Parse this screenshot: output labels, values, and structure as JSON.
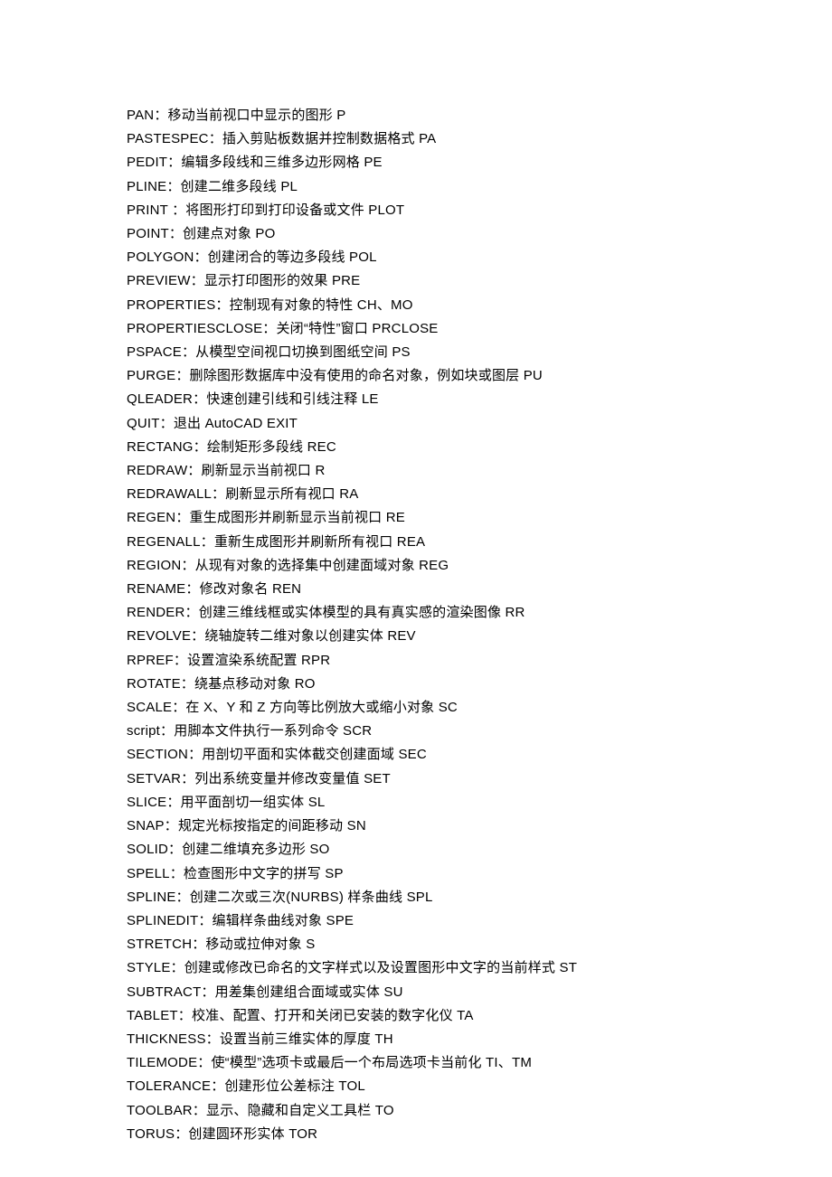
{
  "lines": [
    "PAN：移动当前视口中显示的图形 P",
    "PASTESPEC：插入剪贴板数据并控制数据格式 PA",
    "PEDIT：编辑多段线和三维多边形网格 PE",
    "PLINE：创建二维多段线 PL",
    "PRINT ：将图形打印到打印设备或文件 PLOT",
    "POINT：创建点对象 PO",
    "POLYGON：创建闭合的等边多段线 POL",
    "PREVIEW：显示打印图形的效果 PRE",
    "PROPERTIES：控制现有对象的特性 CH、MO",
    "PROPERTIESCLOSE：关闭“特性”窗口 PRCLOSE",
    "PSPACE：从模型空间视口切换到图纸空间 PS",
    "PURGE：删除图形数据库中没有使用的命名对象，例如块或图层 PU",
    "QLEADER：快速创建引线和引线注释 LE",
    "QUIT：退出 AutoCAD EXIT",
    "RECTANG：绘制矩形多段线 REC",
    "REDRAW：刷新显示当前视口 R",
    "REDRAWALL：刷新显示所有视口 RA",
    "REGEN：重生成图形并刷新显示当前视口 RE",
    "REGENALL：重新生成图形并刷新所有视口 REA",
    "REGION：从现有对象的选择集中创建面域对象 REG",
    "RENAME：修改对象名 REN",
    "RENDER：创建三维线框或实体模型的具有真实感的渲染图像 RR",
    "REVOLVE：绕轴旋转二维对象以创建实体 REV",
    "RPREF：设置渲染系统配置 RPR",
    "ROTATE：绕基点移动对象 RO",
    "SCALE：在 X、Y 和 Z 方向等比例放大或缩小对象 SC",
    "script：用脚本文件执行一系列命令 SCR",
    "SECTION：用剖切平面和实体截交创建面域 SEC",
    "SETVAR：列出系统变量并修改变量值 SET",
    "SLICE：用平面剖切一组实体 SL",
    "SNAP：规定光标按指定的间距移动 SN",
    "SOLID：创建二维填充多边形 SO",
    "SPELL：检查图形中文字的拼写 SP",
    "SPLINE：创建二次或三次(NURBS) 样条曲线 SPL",
    "SPLINEDIT：编辑样条曲线对象 SPE",
    "STRETCH：移动或拉伸对象 S",
    "STYLE：创建或修改已命名的文字样式以及设置图形中文字的当前样式 ST",
    "SUBTRACT：用差集创建组合面域或实体 SU",
    "TABLET：校准、配置、打开和关闭已安装的数字化仪 TA",
    "THICKNESS：设置当前三维实体的厚度 TH",
    "TILEMODE：使“模型”选项卡或最后一个布局选项卡当前化 TI、TM",
    "TOLERANCE：创建形位公差标注 TOL",
    "TOOLBAR：显示、隐藏和自定义工具栏 TO",
    "TORUS：创建圆环形实体 TOR"
  ]
}
